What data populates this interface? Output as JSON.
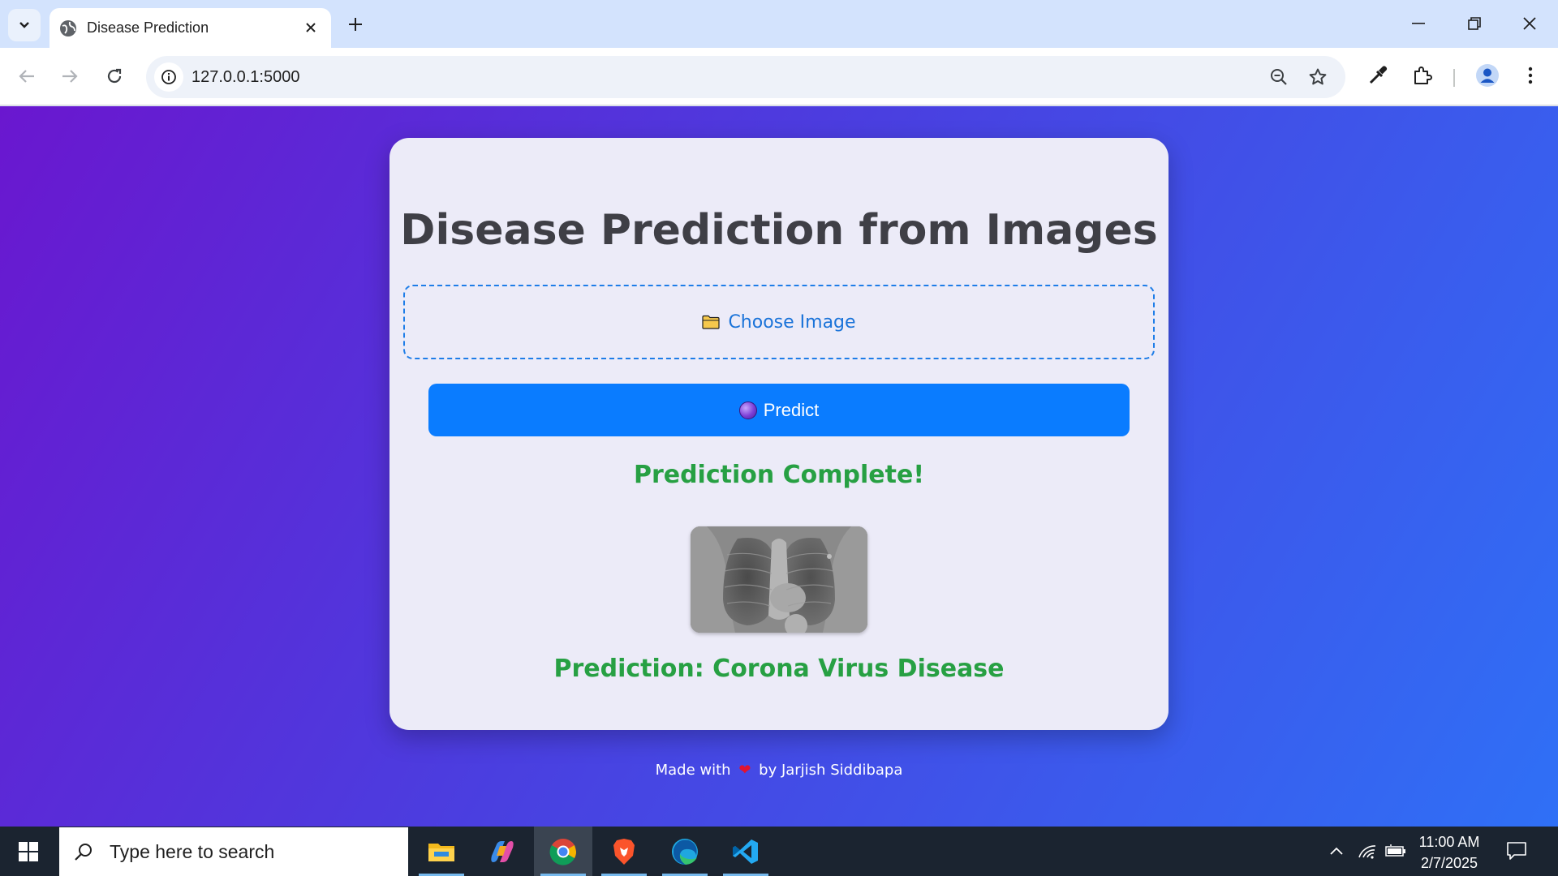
{
  "browser": {
    "tab_title": "Disease Prediction",
    "url": "127.0.0.1:5000"
  },
  "page": {
    "heading": "Disease Prediction from Images",
    "choose_label": "Choose Image",
    "predict_label": "Predict",
    "status": "Prediction Complete!",
    "result": "Prediction: Corona Virus Disease",
    "footer_prefix": "Made with",
    "footer_suffix": "by Jarjish Siddibapa"
  },
  "taskbar": {
    "search_placeholder": "Type here to search",
    "apps": [
      "file-explorer",
      "copilot",
      "chrome",
      "brave",
      "edge",
      "vscode"
    ],
    "time": "11:00 AM",
    "date": "2/7/2025"
  },
  "colors": {
    "accent_button": "#0a7cff",
    "success_text": "#27a043",
    "link_text": "#1a73d9"
  }
}
